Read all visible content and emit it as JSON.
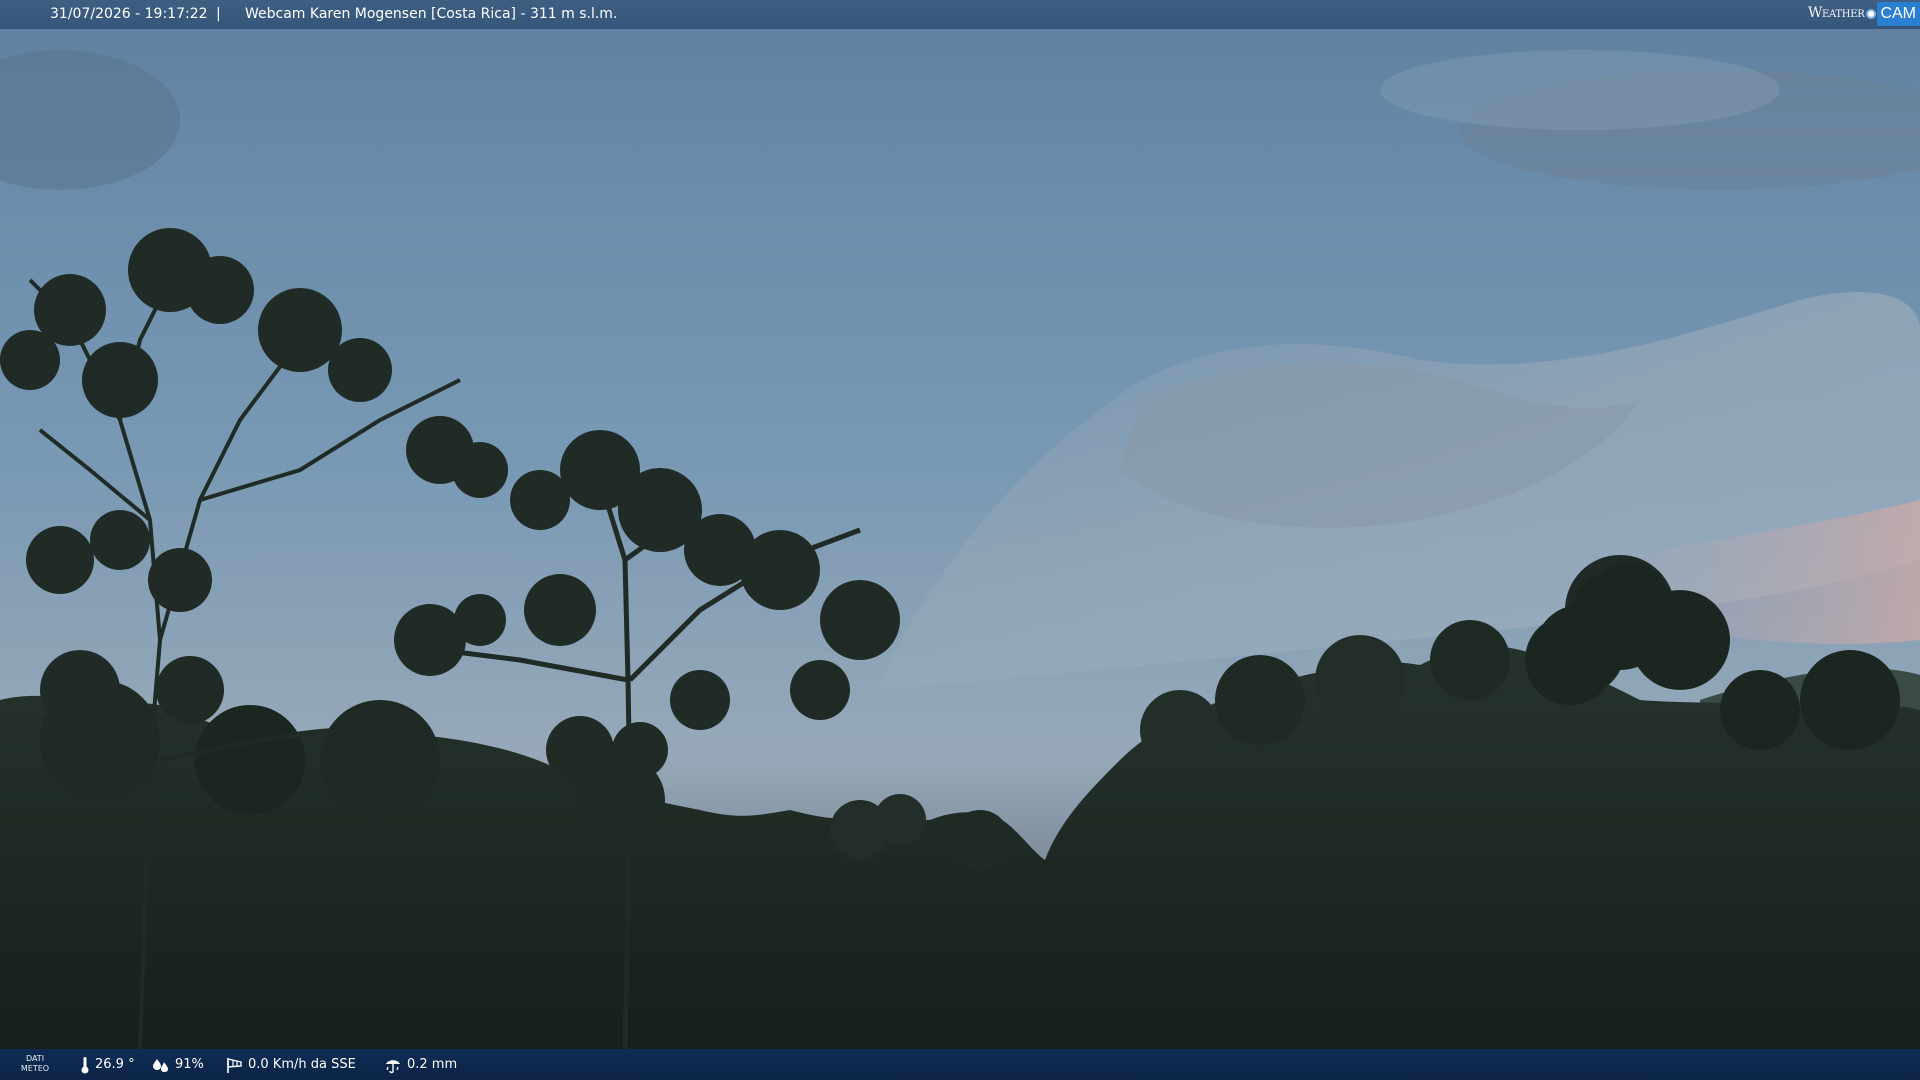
{
  "header": {
    "datetime": "31/07/2026 - 19:17:22",
    "separator": "|",
    "title": "Webcam Karen Mogensen [Costa Rica]  - 311 m s.l.m.",
    "brand_weather": "Weather",
    "brand_cam": "CAM"
  },
  "footer": {
    "dati_line1": "DATI",
    "dati_line2": "METEO",
    "temperature": "26.9 °",
    "humidity": "91%",
    "wind": "0.0 Km/h da SSE",
    "rain": "0.2 mm"
  },
  "icons": {
    "temperature": "thermometer-icon",
    "humidity": "humidity-drops-icon",
    "wind": "windsock-icon",
    "rain": "rain-gauge-icon",
    "brand": "weathercam-logo"
  },
  "colors": {
    "top_bar": "#3a5b7e",
    "bottom_bar": "#0d2a50",
    "brand_cam": "#2a7fd0",
    "sky": "#7898b3",
    "foliage": "#1c2820"
  }
}
